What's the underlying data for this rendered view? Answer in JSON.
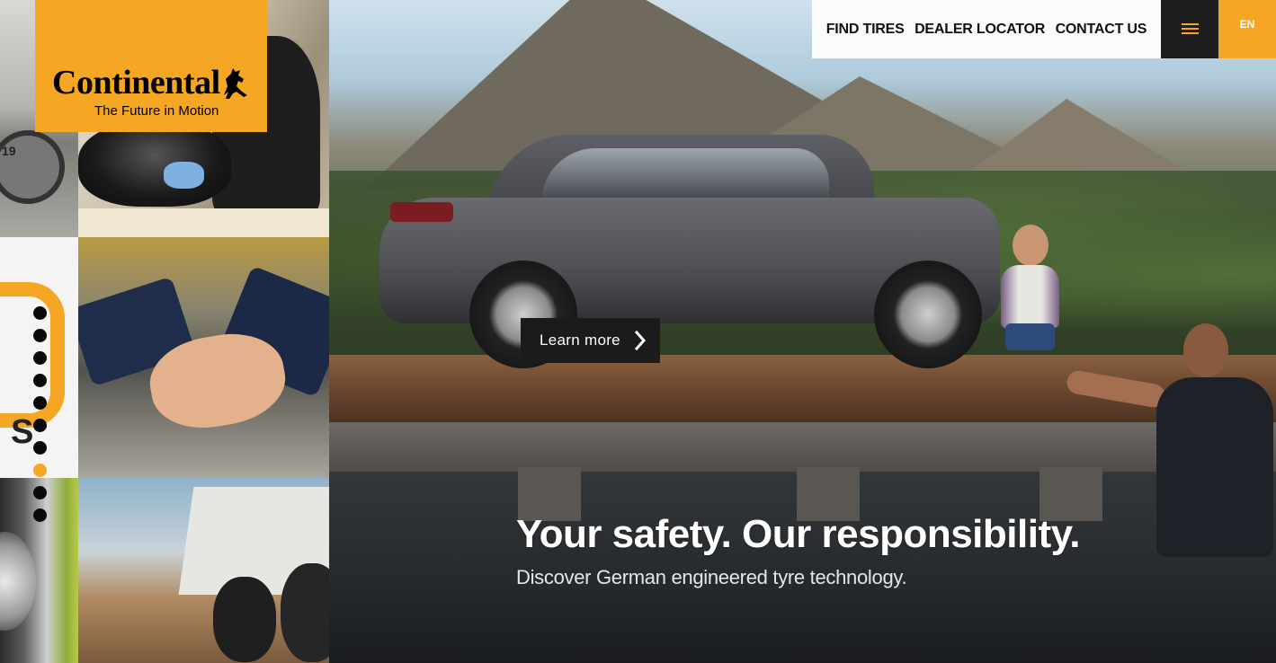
{
  "brand": {
    "name": "Continental",
    "tagline": "The Future in Motion",
    "color": "#f5a623"
  },
  "nav": {
    "links": [
      "FIND TIRES",
      "DEALER LOCATOR",
      "CONTACT US"
    ],
    "menu_icon": "hamburger-icon",
    "language": "EN"
  },
  "hero": {
    "cta_label": "Learn more",
    "cta_icon": "chevron-right-icon",
    "title": "Your safety. Our responsibility.",
    "subtitle": "Discover German engineered tyre technology."
  },
  "slider": {
    "total": 10,
    "active_index": 7
  },
  "collage": {
    "racecar_number": "19"
  }
}
